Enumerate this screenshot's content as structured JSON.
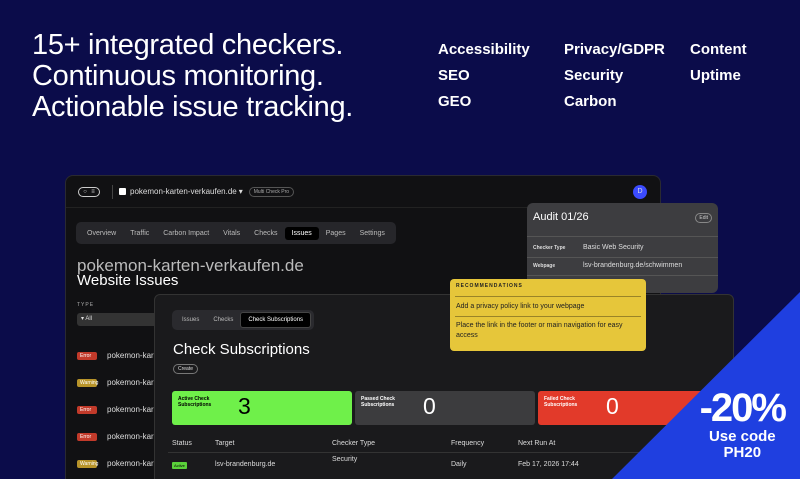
{
  "headline": {
    "line1": "15+ integrated checkers.",
    "line2": "Continuous monitoring.",
    "line3": "Actionable issue tracking."
  },
  "features": [
    "Accessibility",
    "Privacy/GDPR",
    "Content",
    "SEO",
    "Security",
    "Uptime",
    "GEO",
    "Carbon"
  ],
  "app": {
    "site_selector": "pokemon-karten-verkaufen.de",
    "plan_pill": "Multi Check Pro",
    "avatar_letter": "D",
    "tabs": [
      "Overview",
      "Traffic",
      "Carbon Impact",
      "Vitals",
      "Checks",
      "Issues",
      "Pages",
      "Settings"
    ],
    "active_tab": "Issues",
    "site_name": "pokemon-karten-verkaufen.de",
    "page_title": "Website Issues",
    "type_label": "TYPE",
    "type_filter": "All",
    "issue_rows": [
      {
        "severity": "Error",
        "site": "pokemon-kar"
      },
      {
        "severity": "Warning",
        "site": "pokemon-kar"
      },
      {
        "severity": "Error",
        "site": "pokemon-kar"
      },
      {
        "severity": "Error",
        "site": "pokemon-kar"
      },
      {
        "severity": "Warning",
        "site": "pokemon-kar"
      }
    ]
  },
  "audit": {
    "title": "Audit 01/26",
    "edit": "Edit",
    "checker_type_label": "Checker Type",
    "checker_type_value": "Basic Web Security",
    "webpage_label": "Webpage",
    "webpage_value": "lsv-brandenburg.de/schwimmen"
  },
  "recommendations": {
    "heading": "RECOMMENDATIONS",
    "item1": "Add a privacy policy link to your webpage",
    "item2": "Place the link in the footer or main navigation for easy access"
  },
  "subscriptions": {
    "tabs": [
      "Issues",
      "Checks",
      "Check Subscriptions"
    ],
    "active_tab": "Check Subscriptions",
    "title": "Check Subscriptions",
    "create": "Create",
    "cards": [
      {
        "label": "Active Check Subscriptions",
        "value": "3",
        "color": "#6ff04a"
      },
      {
        "label": "Passed Check Subscriptions",
        "value": "0",
        "color": "#3c3c3e"
      },
      {
        "label": "Failed Check Subscriptions",
        "value": "0",
        "color": "#e23a2a"
      }
    ],
    "columns": [
      "Status",
      "Target",
      "Checker Type",
      "Frequency",
      "Next Run At"
    ],
    "row": {
      "status": "Active",
      "target": "lsv-brandenburg.de",
      "checker": "Security",
      "frequency": "Daily",
      "next_run": "Feb 17, 2026 17:44"
    }
  },
  "promo": {
    "discount": "-20%",
    "code_line1": "Use code",
    "code_line2": "PH20",
    "color": "#1f3fe0"
  }
}
